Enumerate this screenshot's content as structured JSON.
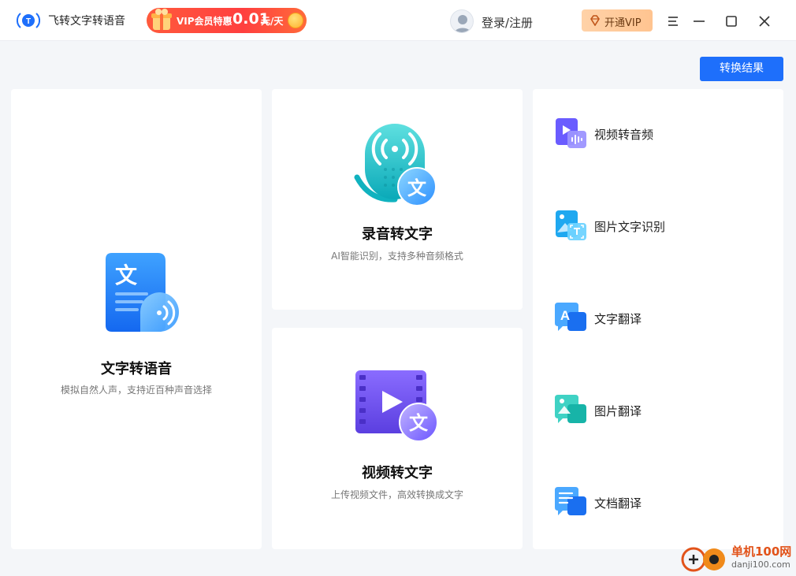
{
  "app": {
    "title": "飞转文字转语音"
  },
  "promo": {
    "text": "VIP会员特惠",
    "price": "0.01",
    "unit": "元/天"
  },
  "header": {
    "login_label": "登录/注册",
    "vip_label": "开通VIP"
  },
  "toolbar": {
    "convert_result_label": "转换结果"
  },
  "cards": {
    "tts": {
      "title": "文字转语音",
      "desc": "模拟自然人声，支持近百种声音选择"
    },
    "recording": {
      "title": "录音转文字",
      "desc": "AI智能识别，支持多种音频格式"
    },
    "video": {
      "title": "视频转文字",
      "desc": "上传视频文件，高效转换成文字"
    }
  },
  "tools": [
    {
      "label": "视频转音频",
      "icon": "video-to-audio-icon"
    },
    {
      "label": "图片文字识别",
      "icon": "image-ocr-icon"
    },
    {
      "label": "文字翻译",
      "icon": "text-translate-icon"
    },
    {
      "label": "图片翻译",
      "icon": "image-translate-icon"
    },
    {
      "label": "文档翻译",
      "icon": "document-translate-icon"
    }
  ],
  "icon_glyphs": {
    "wen": "文",
    "letter_a": "A"
  },
  "watermark": {
    "name": "单机100网",
    "url": "danji100.com"
  },
  "colors": {
    "accent": "#1e6ffb",
    "promo": "#ff4a3c",
    "vip": "#ffc898"
  }
}
